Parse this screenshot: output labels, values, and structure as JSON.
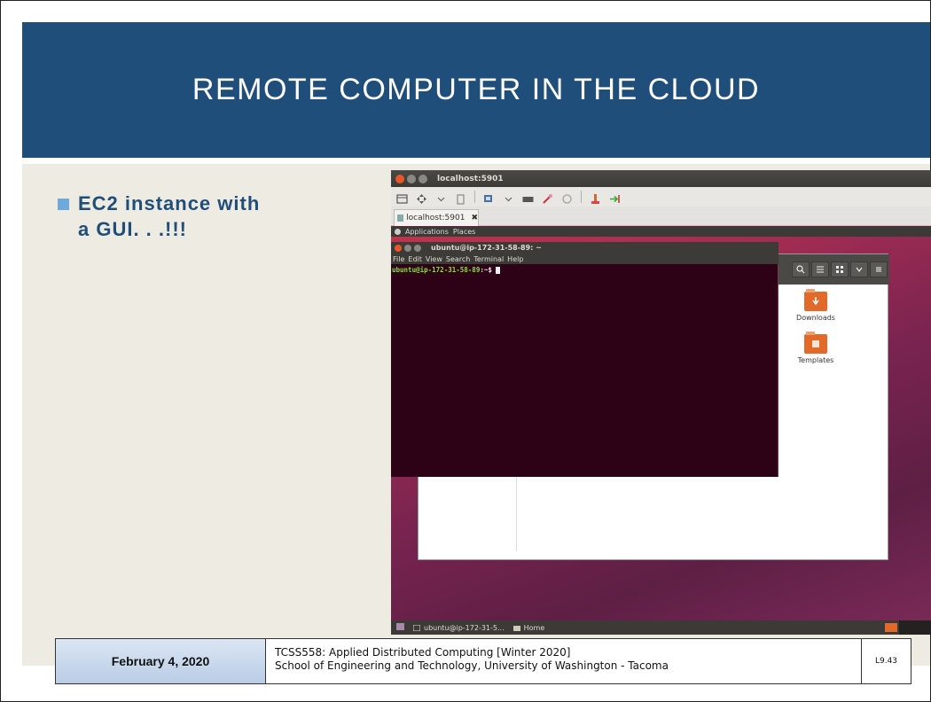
{
  "slide": {
    "title": "REMOTE COMPUTER IN THE CLOUD",
    "bullet": "EC2 instance with a GUI. . .!!!"
  },
  "vnc": {
    "window_title": "localhost:5901",
    "tab_label": "localhost:5901",
    "tab_close": "✖"
  },
  "remote": {
    "panel": {
      "applications": "Applications",
      "places": "Places"
    },
    "terminal": {
      "title": "ubuntu@ip-172-31-58-89: ~",
      "menu": [
        "File",
        "Edit",
        "View",
        "Search",
        "Terminal",
        "Help"
      ],
      "prompt_user": "ubuntu@ip-172-31-58-89",
      "prompt_path": ":~$"
    },
    "file_manager": {
      "items": [
        "Downloads",
        "Templates"
      ]
    },
    "taskbar": {
      "terminal_task": "ubuntu@ip-172-31-5...",
      "home_task": "Home"
    }
  },
  "footer": {
    "date": "February 4, 2020",
    "course_line1": "TCSS558: Applied Distributed Computing [Winter 2020]",
    "course_line2": "School of Engineering and Technology, University of Washington - Tacoma",
    "slide_number": "L9.43"
  },
  "colors": {
    "title_bar": "#1f4e7a",
    "content_bg": "#eeebe2",
    "bullet_text": "#1f4e7a",
    "bullet_marker": "#6fa8dc",
    "terminal_bg": "#2d0116",
    "prompt_green": "#8ae234",
    "footer_date_bg": "#c9d9ec"
  }
}
